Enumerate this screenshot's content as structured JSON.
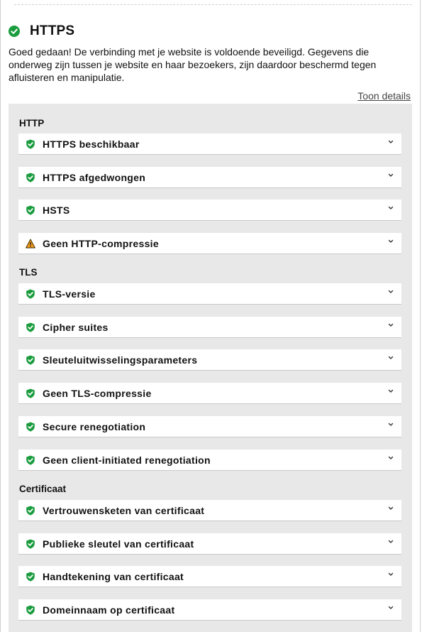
{
  "header": {
    "title": "HTTPS",
    "status": "pass",
    "intro": "Goed gedaan! De verbinding met je website is voldoende beveiligd. Gegevens die onderweg zijn tussen je website en haar bezoekers, zijn daardoor beschermd tegen afluisteren en manipulatie.",
    "details_link": "Toon details"
  },
  "colors": {
    "pass": "#1a9c3e",
    "warning": "#f29a1a",
    "panel_bg": "#e8e8e8"
  },
  "sections": [
    {
      "title": "HTTP",
      "items": [
        {
          "label": "HTTPS beschikbaar",
          "status": "pass",
          "icon": "shield-check-icon"
        },
        {
          "label": "HTTPS afgedwongen",
          "status": "pass",
          "icon": "shield-check-icon"
        },
        {
          "label": "HSTS",
          "status": "pass",
          "icon": "shield-check-icon"
        },
        {
          "label": "Geen HTTP-compressie",
          "status": "warning",
          "icon": "warning-triangle-icon"
        }
      ]
    },
    {
      "title": "TLS",
      "items": [
        {
          "label": "TLS-versie",
          "status": "pass",
          "icon": "shield-check-icon"
        },
        {
          "label": "Cipher suites",
          "status": "pass",
          "icon": "shield-check-icon"
        },
        {
          "label": "Sleuteluitwisselingsparameters",
          "status": "pass",
          "icon": "shield-check-icon"
        },
        {
          "label": "Geen TLS-compressie",
          "status": "pass",
          "icon": "shield-check-icon"
        },
        {
          "label": "Secure renegotiation",
          "status": "pass",
          "icon": "shield-check-icon"
        },
        {
          "label": "Geen client-initiated renegotiation",
          "status": "pass",
          "icon": "shield-check-icon"
        }
      ]
    },
    {
      "title": "Certificaat",
      "items": [
        {
          "label": "Vertrouwensketen van certificaat",
          "status": "pass",
          "icon": "shield-check-icon"
        },
        {
          "label": "Publieke sleutel van certificaat",
          "status": "pass",
          "icon": "shield-check-icon"
        },
        {
          "label": "Handtekening van certificaat",
          "status": "pass",
          "icon": "shield-check-icon"
        },
        {
          "label": "Domeinnaam op certificaat",
          "status": "pass",
          "icon": "shield-check-icon"
        }
      ]
    }
  ]
}
